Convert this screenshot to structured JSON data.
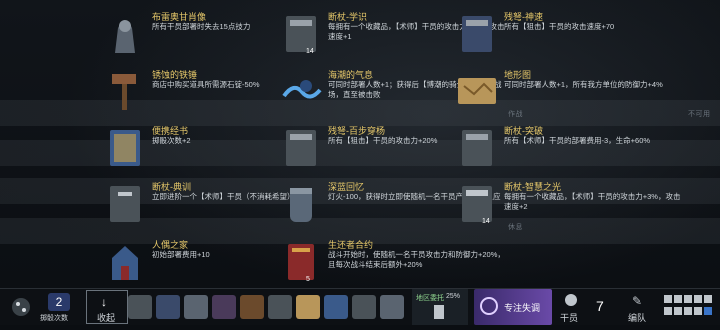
{
  "relics": [
    {
      "name": "布雷奥甘肖像",
      "desc": "所有干员部署时失去15点技力",
      "badge": ""
    },
    {
      "name": "断杖-学识",
      "desc": "每拥有一个收藏品，【术师】干员的攻击力+2%，攻击速度+1",
      "badge": "14"
    },
    {
      "name": "残弩-神速",
      "desc": "所有【狙击】干员的攻击速度+70",
      "badge": ""
    },
    {
      "name": "锈蚀的铁锤",
      "desc": "商店中购买道具所需源石锭-50%",
      "badge": ""
    },
    {
      "name": "海潮的气息",
      "desc": "可同时部署人数+1；获得后【博潮的骑士】出现在战场，直至被击败",
      "badge": ""
    },
    {
      "name": "地形图",
      "desc": "可同时部署人数+1，所有我方单位的防御力+4%",
      "badge": ""
    },
    {
      "name": "便携经书",
      "desc": "掷骰次数+2",
      "badge": ""
    },
    {
      "name": "残弩-百步穿杨",
      "desc": "所有【狙击】干员的攻击力+20%",
      "badge": ""
    },
    {
      "name": "断杖-突破",
      "desc": "所有【术师】干员的部署费用-3，生命+60%",
      "badge": ""
    },
    {
      "name": "断杖-典训",
      "desc": "立即进阶一个【术师】干员（不消耗希望）",
      "badge": ""
    },
    {
      "name": "深蓝回忆",
      "desc": "灯火-100，获得时立即使随机一名干员产生排异反应",
      "badge": ""
    },
    {
      "name": "断杖-智慧之光",
      "desc": "每拥有一个收藏品，【术师】干员的攻击力+3%，攻击速度+2",
      "badge": "14"
    },
    {
      "name": "人偶之家",
      "desc": "初始部署费用+10",
      "badge": ""
    },
    {
      "name": "生还者合约",
      "desc": "战斗开始时，使随机一名干员攻击力和防御力+20%，且每次战斗结束后额外+20%",
      "badge": "5"
    }
  ],
  "ghost": {
    "work": "作战",
    "fail": "不可用",
    "wait": "休息"
  },
  "bar": {
    "dice_count": "2",
    "dice_label": "掷骰次数",
    "collapse_label": "收起",
    "sector_label": "地区委托",
    "sector_pct": "25%",
    "focus_label": "专注失调",
    "operator_label": "干员",
    "operator_count": "7",
    "squad_label": "编队"
  },
  "colors": {
    "name": "#e6c86a",
    "accent": "#8a63d2"
  }
}
